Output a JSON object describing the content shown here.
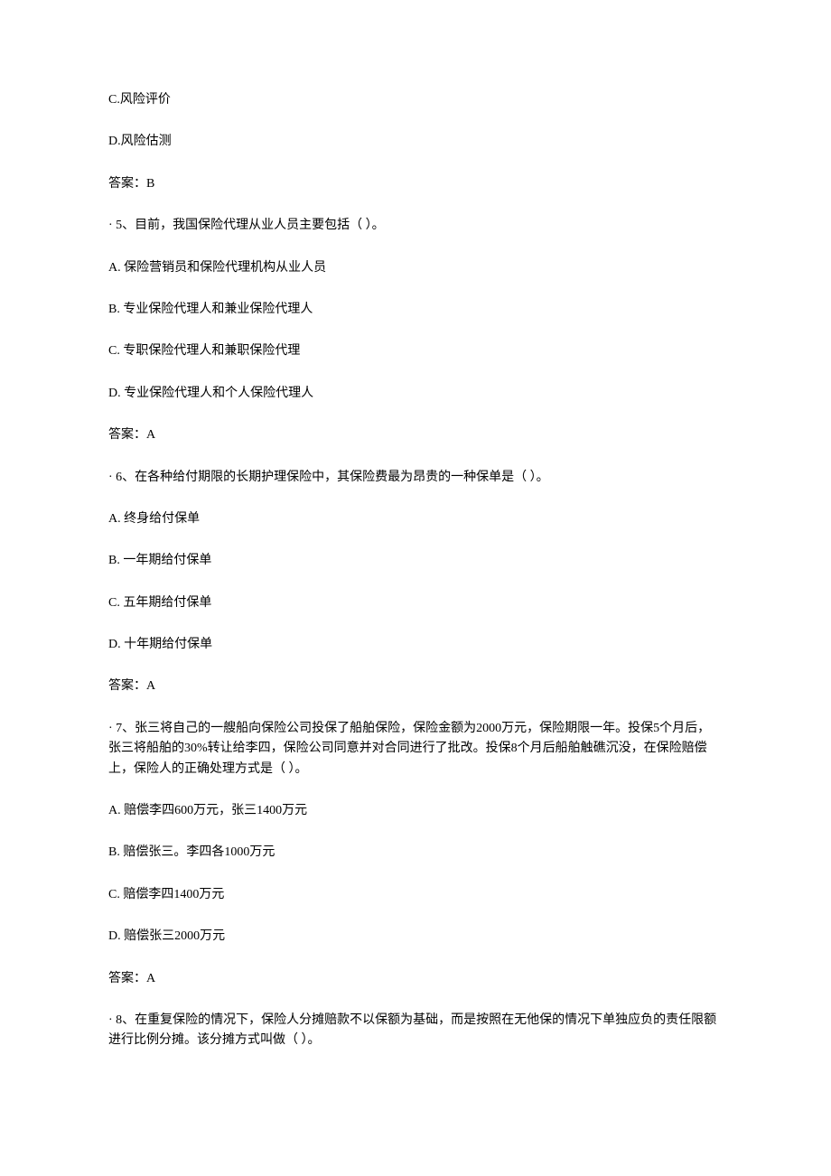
{
  "q4_partial": {
    "option_c": "C.风险评价",
    "option_d": "D.风险估测",
    "answer": "答案：B"
  },
  "q5": {
    "stem": "· 5、目前，我国保险代理从业人员主要包括（ ）。",
    "option_a": "A. 保险营销员和保险代理机构从业人员",
    "option_b": "B. 专业保险代理人和兼业保险代理人",
    "option_c": "C. 专职保险代理人和兼职保险代理",
    "option_d": "D. 专业保险代理人和个人保险代理人",
    "answer": "答案：A"
  },
  "q6": {
    "stem": "· 6、在各种给付期限的长期护理保险中，其保险费最为昂贵的一种保单是（ ）。",
    "option_a": "A. 终身给付保单",
    "option_b": "B. 一年期给付保单",
    "option_c": "C. 五年期给付保单",
    "option_d": "D. 十年期给付保单",
    "answer": "答案：A"
  },
  "q7": {
    "stem": "· 7、张三将自己的一艘船向保险公司投保了船舶保险，保险金额为2000万元，保险期限一年。投保5个月后，张三将船舶的30%转让给李四，保险公司同意并对合同进行了批改。投保8个月后船舶触礁沉没，在保险赔偿上，保险人的正确处理方式是（ ）。",
    "option_a": "A. 赔偿李四600万元，张三1400万元",
    "option_b": "B. 赔偿张三。李四各1000万元",
    "option_c": "C. 赔偿李四1400万元",
    "option_d": "D. 赔偿张三2000万元",
    "answer": "答案：A"
  },
  "q8": {
    "stem": "· 8、在重复保险的情况下，保险人分摊赔款不以保额为基础，而是按照在无他保的情况下单独应负的责任限额进行比例分摊。该分摊方式叫做（ ）。"
  }
}
